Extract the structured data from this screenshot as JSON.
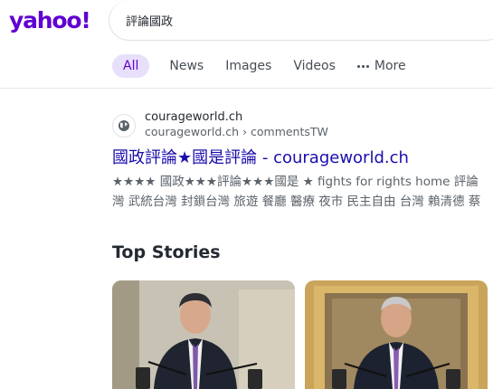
{
  "brand": {
    "logo_text": "yahoo!",
    "accent_color": "#6001d2"
  },
  "search": {
    "query": "評論國政"
  },
  "tabs": [
    {
      "label": "All",
      "active": true
    },
    {
      "label": "News",
      "active": false
    },
    {
      "label": "Images",
      "active": false
    },
    {
      "label": "Videos",
      "active": false
    },
    {
      "label": "More",
      "active": false,
      "icon": "more-dots-icon"
    }
  ],
  "result": {
    "favicon": "globe-icon",
    "site_name": "courageworld.ch",
    "site_url": "courageworld.ch › commentsTW",
    "title": "國政評論★國是評論 - courageworld.ch",
    "title_color": "#1a0dab",
    "snippet_line1": "★★★★ 國政★★★評論★★★國是 ★ fights for rights home 評論",
    "snippet_line2": "灣 武統台灣 封鎖台灣 旅遊 餐廳 醫療 夜市 民主自由 台灣 賴清德 蔡"
  },
  "top_stories": {
    "heading": "Top Stories",
    "cards": [
      {
        "image": "news-photo-speaker-podium"
      },
      {
        "image": "news-photo-speaker-gold-frame"
      }
    ]
  }
}
